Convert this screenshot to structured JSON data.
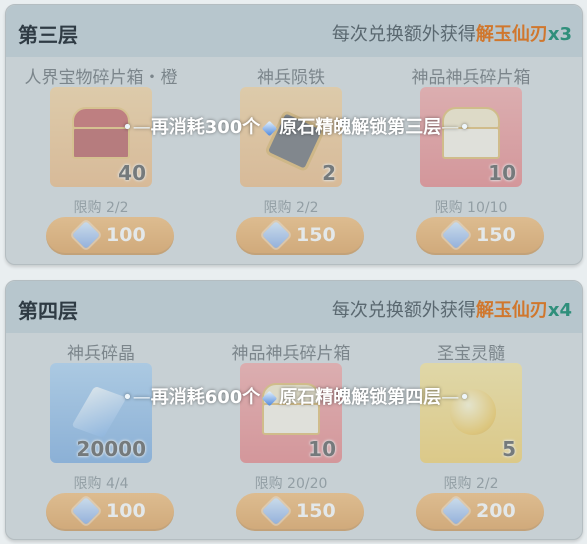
{
  "tiers": [
    {
      "title": "第三层",
      "bonus": {
        "prefix": "每次兑换额外获得",
        "item": "解玉仙刃",
        "multiplier": "x3"
      },
      "lock_message": {
        "text": "再消耗300个",
        "suffix": "原石精魄解锁第三层"
      },
      "items": [
        {
          "name": "人界宝物碎片箱・橙",
          "quantity": "40",
          "limit": "限购 2/2",
          "price": "100",
          "icon": "red-chest-icon"
        },
        {
          "name": "神兵陨铁",
          "quantity": "2",
          "limit": "限购 2/2",
          "price": "150",
          "icon": "meteorite-ore-icon"
        },
        {
          "name": "神品神兵碎片箱",
          "quantity": "10",
          "limit": "限购 10/10",
          "price": "150",
          "icon": "ornate-chest-icon"
        }
      ]
    },
    {
      "title": "第四层",
      "bonus": {
        "prefix": "每次兑换额外获得",
        "item": "解玉仙刃",
        "multiplier": "x4"
      },
      "lock_message": {
        "text": "再消耗600个",
        "suffix": "原石精魄解锁第四层"
      },
      "items": [
        {
          "name": "神兵碎晶",
          "quantity": "20000",
          "limit": "限购 4/4",
          "price": "100",
          "icon": "crystal-shard-icon"
        },
        {
          "name": "神品神兵碎片箱",
          "quantity": "10",
          "limit": "限购 20/20",
          "price": "150",
          "icon": "ornate-chest-icon"
        },
        {
          "name": "圣宝灵髓",
          "quantity": "5",
          "limit": "限购 2/2",
          "price": "200",
          "icon": "golden-orb-icon"
        }
      ]
    }
  ],
  "currency_icon": "gem-icon",
  "colors": {
    "accent_orange": "#d8811f",
    "bonus_item": "#d0772d",
    "multiplier": "#2f8f7b"
  }
}
